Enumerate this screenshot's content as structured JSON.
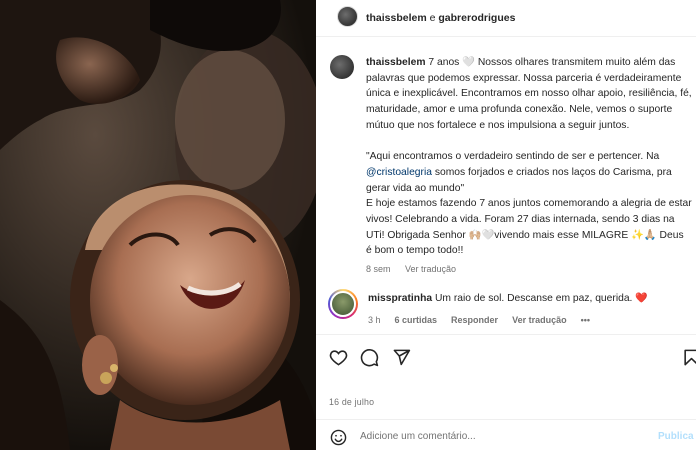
{
  "post_header": {
    "user1": "thaissbelem",
    "joiner": "e",
    "user2": "gabrerodrigues"
  },
  "caption": {
    "username": "thaissbelem",
    "para1": "7 anos 🤍 Nossos olhares transmitem muito além das palavras que podemos expressar. Nossa parceria é verdadeiramente única e inexplicável. Encontramos em nosso olhar apoio, resiliência, fé, maturidade, amor e uma profunda conexão. Nele, vemos o suporte mútuo que nos fortalece e nos impulsiona a seguir juntos.",
    "quote_start": "\"Aqui encontramos o verdadeiro sentindo de ser e pertencer. Na ",
    "mention": "@cristoalegria",
    "quote_end": " somos forjados e criados nos laços do Carisma, pra gerar vida ao mundo\"",
    "para3": "E hoje estamos fazendo 7 anos juntos comemorando a alegria de estar vivos! Celebrando a vida. Foram 27 dias internada, sendo 3 dias na UTi! Obrigada Senhor 🙌🏼🤍vivendo mais esse MILAGRE ✨🙏🏼 Deus é bom o tempo todo!!",
    "time": "8 sem",
    "view_translation": "Ver tradução"
  },
  "comment": {
    "username": "misspratinha",
    "text": "Um raio de sol. Descanse em paz, querida.",
    "heart": "❤️",
    "time": "3 h",
    "likes": "6 curtidas",
    "reply": "Responder",
    "view_translation": "Ver tradução",
    "more": "•••"
  },
  "date": "16 de julho",
  "add_comment": {
    "placeholder": "Adicione um comentário...",
    "publish": "Publica"
  },
  "icons": [
    "heart-icon",
    "comment-icon",
    "share-icon",
    "bookmark-icon",
    "emoji-icon"
  ]
}
